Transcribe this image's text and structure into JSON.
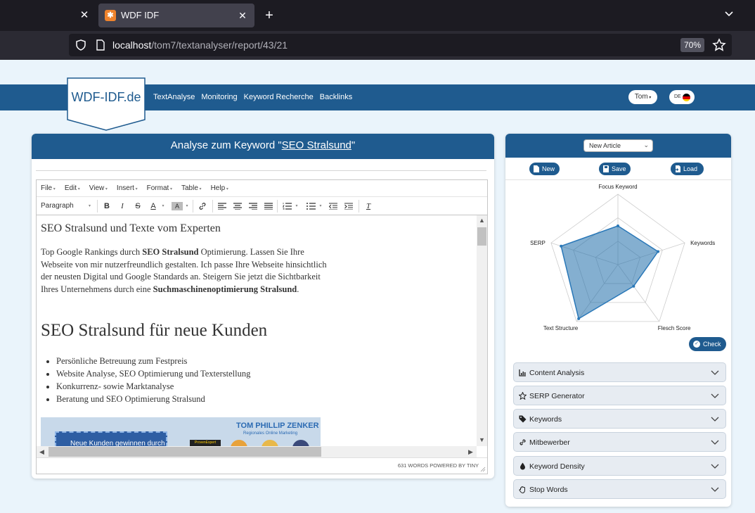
{
  "browser": {
    "tab_title": "WDF IDF",
    "url_host": "localhost",
    "url_path": "/tom7/textanalyser/report/43/21",
    "zoom": "70%"
  },
  "site": {
    "logo": "WDF-IDF.de",
    "nav": [
      "TextAnalyse",
      "Monitoring",
      "Keyword Recherche",
      "Backlinks"
    ],
    "user": "Tom",
    "lang": "DE",
    "brand_color": "#1f5b8f"
  },
  "editor_panel": {
    "heading_prefix": "Analyse zum Keyword \"",
    "keyword": "SEO Stralsund",
    "heading_suffix": "\"",
    "menu": [
      "File",
      "Edit",
      "View",
      "Insert",
      "Format",
      "Table",
      "Help"
    ],
    "block_format": "Paragraph",
    "content": {
      "title": "SEO Stralsund und Texte vom Experten",
      "para_1": "Top Google Rankings durch ",
      "para_bold_1": "SEO Stralsund",
      "para_2": " Optimierung. Lassen Sie Ihre Webseite von mir nutzerfreundlich gestalten. Ich passe Ihre Webseite hinsichtlich der neusten Digital und Google Standards an. Steigern Sie jetzt die Sichtbarkeit Ihres Unternehmens durch eine ",
      "para_bold_2": "Suchmaschinenoptimierung Stralsund",
      "para_3": ".",
      "heading": "SEO Stralsund für neue Kunden",
      "bullets": [
        "Persönliche Betreuung zum Festpreis",
        "Website Analyse, SEO Optimierung und Texterstellung",
        "Konkurrenz- sowie Marktanalyse",
        "Beratung und SEO Optimierung Stralsund"
      ],
      "banner_text": "Neue Kunden gewinnen durch",
      "banner_brand": "TOM PHILLIP ZENKER",
      "banner_sub": "Regionales Online Marketing",
      "banner_pe": "ProvenExpert"
    },
    "status": "631 WORDS POWERED BY TINY"
  },
  "side_panel": {
    "article_select": "New Article",
    "buttons": {
      "new": "New",
      "save": "Save",
      "load": "Load",
      "check": "Check"
    },
    "radar_labels": [
      "Focus Keyword",
      "Keywords",
      "Flesch Score",
      "Text Structure",
      "SERP"
    ],
    "radar_values": [
      0.55,
      0.6,
      0.38,
      0.95,
      0.85
    ],
    "accordion": [
      {
        "label": "Content Analysis",
        "icon": "chart-icon"
      },
      {
        "label": "SERP Generator",
        "icon": "star-icon"
      },
      {
        "label": "Keywords",
        "icon": "tag-icon"
      },
      {
        "label": "Mitbewerber",
        "icon": "link-icon"
      },
      {
        "label": "Keyword Density",
        "icon": "drop-icon"
      },
      {
        "label": "Stop Words",
        "icon": "hand-icon"
      }
    ]
  }
}
